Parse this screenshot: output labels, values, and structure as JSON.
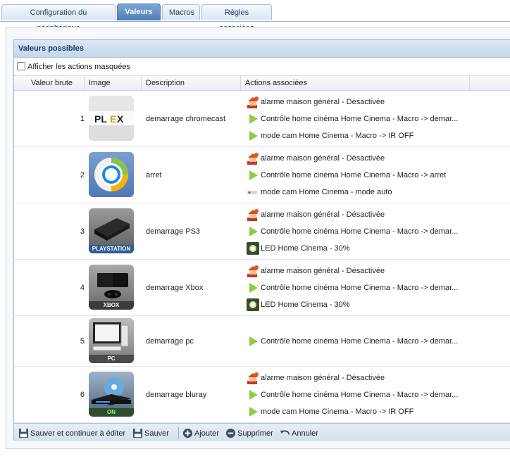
{
  "tabs": [
    {
      "label": "Configuration du périphérique",
      "active": false
    },
    {
      "label": "Valeurs",
      "active": true
    },
    {
      "label": "Macros",
      "active": false
    },
    {
      "label": "Règles associées",
      "active": false
    }
  ],
  "panel": {
    "title": "Valeurs possibles",
    "show_hidden_label": "Afficher les actions masquées",
    "show_hidden_checked": false
  },
  "columns": {
    "raw_value": "Valeur brute",
    "image": "Image",
    "description": "Description",
    "actions": "Actions associées"
  },
  "rows": [
    {
      "value": "1",
      "image": "plex-logo",
      "description": "demarrage chromecast",
      "actions": [
        {
          "icon": "alarm-house-icon",
          "text": "alarme maison général - Désactivée"
        },
        {
          "icon": "play-icon",
          "text": "Contrôle home cinéma Home Cinema - Macro -> demar..."
        },
        {
          "icon": "play-icon",
          "text": "mode cam Home Cinema - Macro -> IR OFF"
        }
      ]
    },
    {
      "value": "2",
      "image": "chromecast-logo",
      "description": "arret",
      "actions": [
        {
          "icon": "alarm-house-icon",
          "text": "alarme maison général - Désactivée"
        },
        {
          "icon": "play-icon",
          "text": "Contrôle home cinéma Home Cinema - Macro -> arret"
        },
        {
          "icon": "camera-icon",
          "text": "mode cam Home Cinema - mode auto"
        }
      ]
    },
    {
      "value": "3",
      "image": "playstation-console",
      "image_label": "PLAYSTATION",
      "description": "demarrage PS3",
      "actions": [
        {
          "icon": "alarm-house-icon",
          "text": "alarme maison général - Désactivée"
        },
        {
          "icon": "play-icon",
          "text": "Contrôle home cinéma Home Cinema - Macro -> demar..."
        },
        {
          "icon": "led-light-icon",
          "text": "LED Home Cinema - 30%"
        }
      ]
    },
    {
      "value": "4",
      "image": "xbox-console",
      "image_label": "XBOX",
      "description": "demarrage Xbox",
      "actions": [
        {
          "icon": "alarm-house-icon",
          "text": "alarme maison général - Désactivée"
        },
        {
          "icon": "play-icon",
          "text": "Contrôle home cinéma Home Cinema - Macro -> demar..."
        },
        {
          "icon": "led-light-icon",
          "text": "LED Home Cinema - 30%"
        }
      ]
    },
    {
      "value": "5",
      "image": "pc-computer",
      "image_label": "PC",
      "description": "demarrage pc",
      "actions": [
        {
          "icon": "play-icon",
          "text": "Contrôle home cinéma Home Cinema - Macro -> demar..."
        }
      ]
    },
    {
      "value": "6",
      "image": "bluray-player",
      "image_label": "ON",
      "description": "demarrage bluray",
      "actions": [
        {
          "icon": "alarm-house-icon",
          "text": "alarme maison général - Désactivée"
        },
        {
          "icon": "play-icon",
          "text": "Contrôle home cinéma Home Cinema - Macro -> demar..."
        },
        {
          "icon": "play-icon",
          "text": "mode cam Home Cinema - Macro -> IR OFF"
        }
      ]
    }
  ],
  "toolbar": {
    "save_continue": "Sauver et continuer à éditer",
    "save": "Sauver",
    "add": "Ajouter",
    "delete": "Supprimer",
    "cancel": "Annuler"
  },
  "colors": {
    "accent": "#4f7fb8",
    "header_text": "#15396a",
    "play_green": "#8fce3c"
  }
}
